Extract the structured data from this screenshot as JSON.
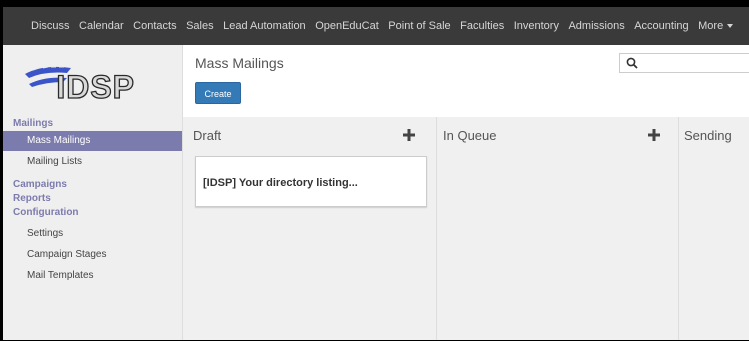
{
  "topnav": {
    "items": [
      "Discuss",
      "Calendar",
      "Contacts",
      "Sales",
      "Lead Automation",
      "OpenEduCat",
      "Point of Sale",
      "Faculties",
      "Inventory",
      "Admissions",
      "Accounting",
      "More"
    ]
  },
  "logo": {
    "text": "IDSP"
  },
  "sidebar": {
    "mailings_header": "Mailings",
    "mass_mailings": "Mass Mailings",
    "mailing_lists": "Mailing Lists",
    "campaigns": "Campaigns",
    "reports": "Reports",
    "configuration": "Configuration",
    "settings": "Settings",
    "campaign_stages": "Campaign Stages",
    "mail_templates": "Mail Templates"
  },
  "main": {
    "title": "Mass Mailings",
    "create_label": "Create",
    "search_placeholder": ""
  },
  "kanban": {
    "columns": [
      {
        "title": "Draft"
      },
      {
        "title": "In Queue"
      },
      {
        "title": "Sending"
      }
    ],
    "card_title": "[IDSP] Your directory listing..."
  },
  "colors": {
    "topbar": "#3a3a3a",
    "accent": "#7c7bad",
    "primary_button": "#337ab7"
  }
}
